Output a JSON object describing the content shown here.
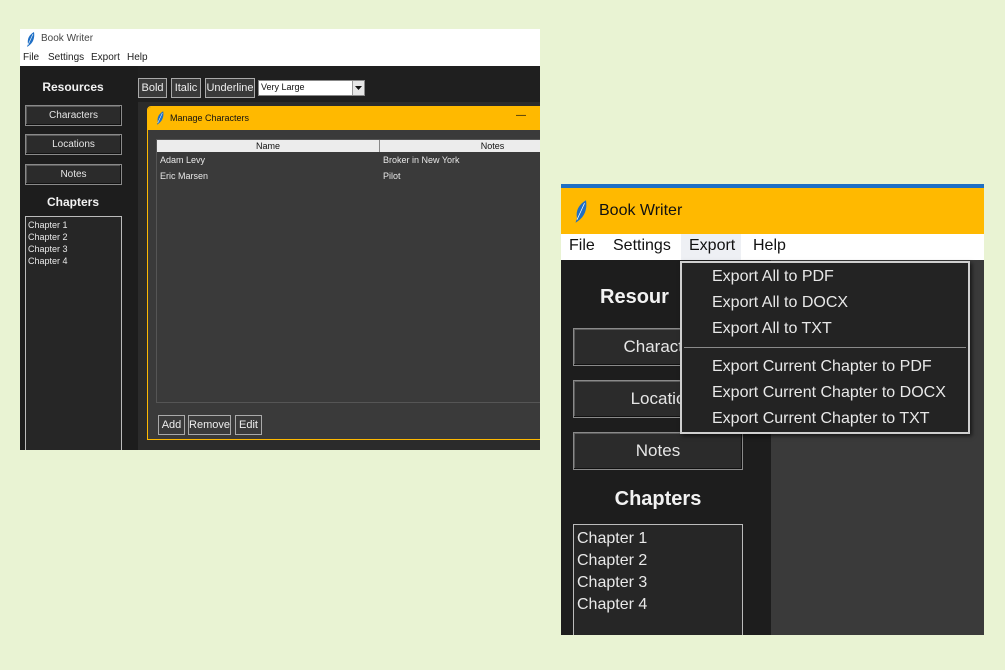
{
  "app_title": "Book Writer",
  "menu": [
    "File",
    "Settings",
    "Export",
    "Help"
  ],
  "sidebar": {
    "resources_heading": "Resources",
    "buttons": [
      "Characters",
      "Locations",
      "Notes"
    ],
    "chapters_heading": "Chapters",
    "chapters": [
      "Chapter 1",
      "Chapter 2",
      "Chapter 3",
      "Chapter 4"
    ]
  },
  "toolbar": {
    "bold": "Bold",
    "italic": "Italic",
    "underline": "Underline",
    "font_size": "Very Large"
  },
  "dialog": {
    "title": "Manage Characters",
    "minimize": "—",
    "columns": [
      "Name",
      "Notes"
    ],
    "rows": [
      {
        "name": "Adam Levy",
        "notes": "Broker in New York"
      },
      {
        "name": "Eric Marsen",
        "notes": "Pilot"
      }
    ],
    "buttons": [
      "Add",
      "Remove",
      "Edit"
    ]
  },
  "zoom": {
    "sidebar_resources_heading": "Resour",
    "sidebar_buttons": [
      "Characte",
      "Locatio",
      "Notes"
    ],
    "export_menu": [
      "Export All to PDF",
      "Export All to DOCX",
      "Export All to TXT",
      "Export Current Chapter to PDF",
      "Export Current Chapter to DOCX",
      "Export Current Chapter to TXT"
    ]
  },
  "colors": {
    "page_bg": "#e9f3d3",
    "app_dark": "#1e1e1e",
    "panel": "#3a3a3a",
    "accent_yellow": "#ffb900",
    "accent_blue": "#1f6fc5"
  }
}
